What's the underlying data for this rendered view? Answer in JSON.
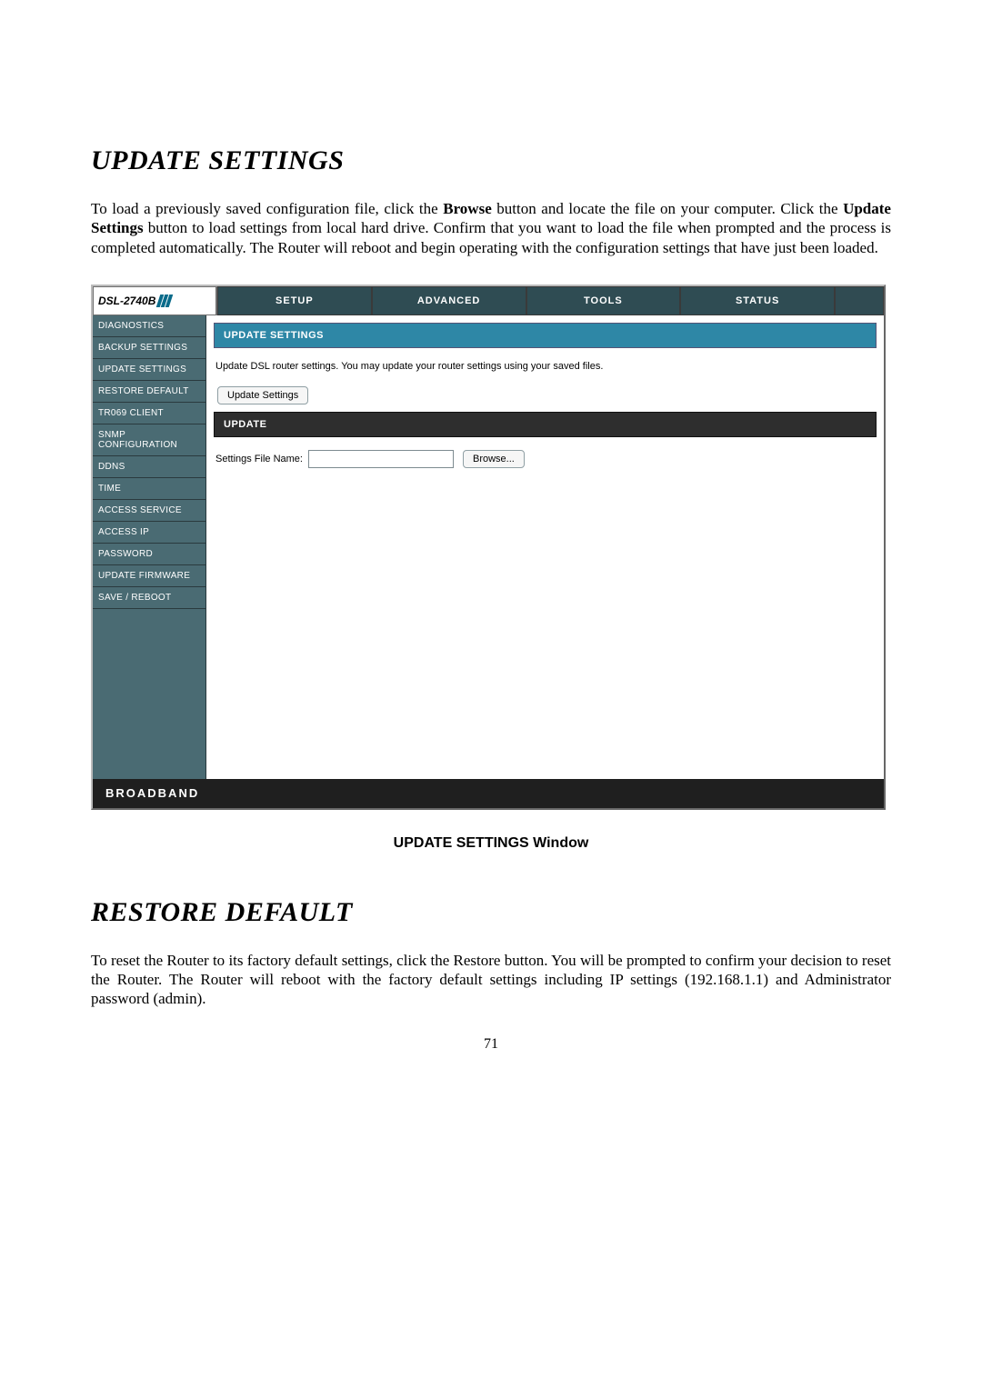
{
  "section1": {
    "heading": "UPDATE SETTINGS",
    "paragraph_pre": "To load a previously saved configuration file, click the ",
    "paragraph_b1": "Browse",
    "paragraph_mid": " button and locate the file on your computer. Click the ",
    "paragraph_b2": "Update Settings",
    "paragraph_post": " button to load settings from local hard drive. Confirm that you want to load the file when prompted and the process is completed automatically. The Router will reboot and begin operating with the configuration settings that have just been loaded."
  },
  "router": {
    "model": "DSL-2740B",
    "tabs": [
      "SETUP",
      "ADVANCED",
      "TOOLS",
      "STATUS"
    ],
    "sidebar": [
      "DIAGNOSTICS",
      "BACKUP SETTINGS",
      "UPDATE SETTINGS",
      "RESTORE DEFAULT",
      "TR069 CLIENT",
      "SNMP CONFIGURATION",
      "DDNS",
      "TIME",
      "ACCESS SERVICE",
      "ACCESS IP",
      "PASSWORD",
      "UPDATE FIRMWARE",
      "SAVE / REBOOT"
    ],
    "panel_title": "UPDATE SETTINGS",
    "panel_desc": "Update DSL router settings. You may update your router settings using your saved files.",
    "update_button": "Update Settings",
    "panel_sub": "UPDATE",
    "form_label": "Settings File Name:",
    "file_value": "",
    "browse_button": "Browse...",
    "footer_brand": "BROADBAND"
  },
  "caption": "UPDATE SETTINGS Window",
  "section2": {
    "heading": "RESTORE DEFAULT",
    "paragraph": "To reset the Router to its factory default settings, click the Restore button. You will be prompted to confirm your decision to reset the Router. The Router will reboot with the factory default settings including IP settings (192.168.1.1) and Administrator password (admin)."
  },
  "page_number": "71"
}
